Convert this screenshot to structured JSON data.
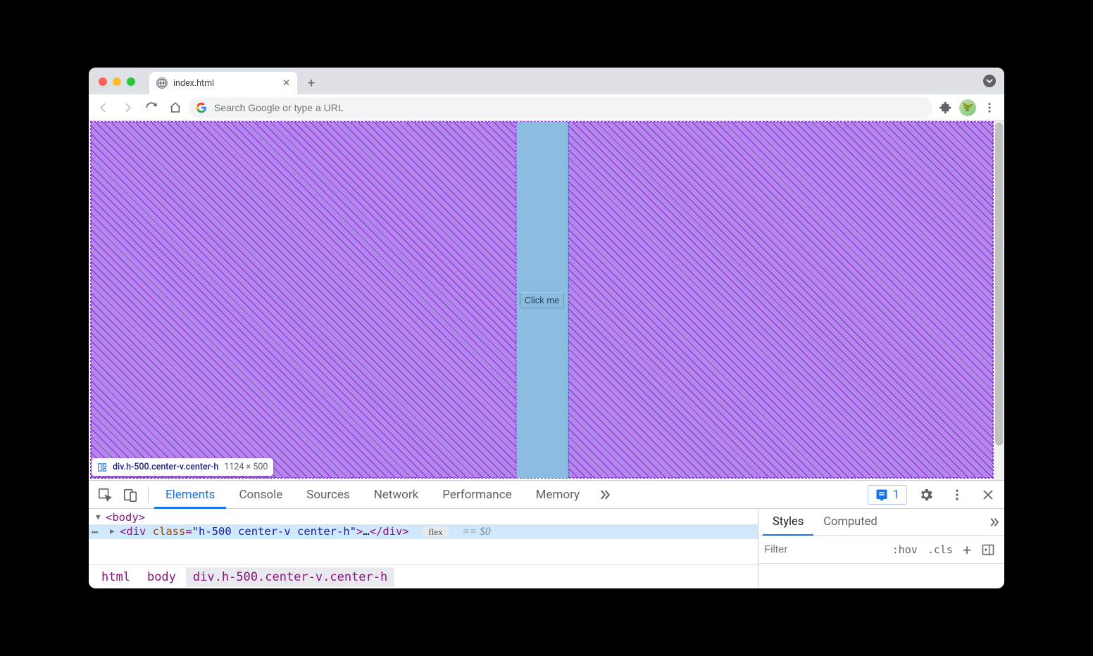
{
  "window": {
    "tab_title": "index.html",
    "omnibox_placeholder": "Search Google or type a URL"
  },
  "page": {
    "button_label": "Click me"
  },
  "overlay": {
    "selector": "div.h-500.center-v.center-h",
    "dimensions": "1124 × 500"
  },
  "devtools": {
    "tabs": [
      "Elements",
      "Console",
      "Sources",
      "Network",
      "Performance",
      "Memory"
    ],
    "active_tab": "Elements",
    "issues_count": "1",
    "dom": {
      "line1_tag": "body",
      "line2_tag_open": "div",
      "line2_attr_name": "class",
      "line2_attr_value": "h-500 center-v center-h",
      "line2_ellipsis": "…",
      "line2_tag_close": "div",
      "line2_badge": "flex",
      "line2_suffix": "== $0"
    },
    "breadcrumbs": [
      "html",
      "body",
      "div.h-500.center-v.center-h"
    ],
    "styles": {
      "tabs": [
        "Styles",
        "Computed"
      ],
      "active": "Styles",
      "filter_placeholder": "Filter",
      "actions": [
        ":hov",
        ".cls",
        "+"
      ]
    }
  }
}
